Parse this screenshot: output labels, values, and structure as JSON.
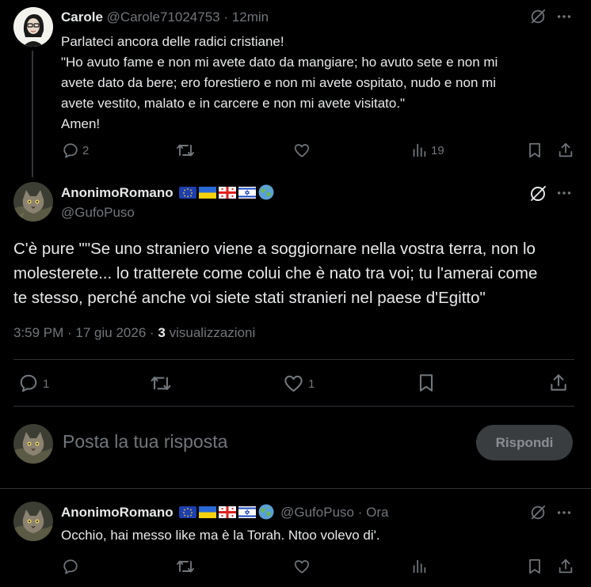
{
  "tweet1": {
    "name": "Carole",
    "handle": "@Carole71024753",
    "dot": "·",
    "time": "12min",
    "lines": [
      "Parlateci ancora delle radici cristiane!",
      "\"Ho avuto fame e non mi avete dato da mangiare; ho avuto sete e non mi",
      "avete dato da bere; ero forestiero e non mi avete ospitato, nudo e non mi",
      "avete vestito, malato e in carcere e non mi avete visitato.\"",
      "Amen!"
    ],
    "replies": "2",
    "views": "19"
  },
  "main_tweet": {
    "name": "AnonimoRomano",
    "handle": "@GufoPuso",
    "lines": [
      "C'è pure \"\"Se uno straniero viene a soggiornare nella vostra terra, non lo",
      "molesterete... lo tratterete come colui che è nato tra voi; tu l'amerai come",
      "te stesso, perché anche voi siete stati stranieri nel paese d'Egitto\""
    ],
    "meta_time": "3:59 PM · 17 giu 2026 ·",
    "views_count": "3",
    "views_label": "visualizzazioni",
    "replies": "1",
    "likes": "1"
  },
  "reply_box": {
    "placeholder": "Posta la tua risposta",
    "button": "Rispondi"
  },
  "reply": {
    "name": "AnonimoRomano",
    "handle": "@GufoPuso",
    "dot": "·",
    "time": "Ora",
    "text": "Occhio, hai messo like ma è la Torah. Ntoo volevo di'."
  },
  "icons": {
    "reply": "reply-icon",
    "repost": "repost-icon",
    "like": "like-icon",
    "views": "views-icon",
    "bookmark": "bookmark-icon",
    "share": "share-icon",
    "grok": "grok-icon",
    "more": "more-icon"
  },
  "colors": {
    "background": "#000000",
    "text": "#e7e9ea",
    "muted": "#71767b",
    "divider": "#2f3336",
    "button_bg": "#3a3d40"
  }
}
